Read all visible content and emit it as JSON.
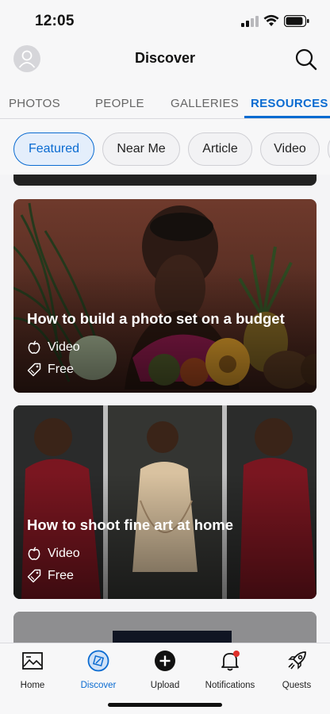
{
  "status_bar": {
    "time": "12:05"
  },
  "header": {
    "title": "Discover",
    "avatar_icon": "person-avatar-icon",
    "search_icon": "search-icon"
  },
  "tabs": [
    {
      "label": "PHOTOS",
      "active": false
    },
    {
      "label": "PEOPLE",
      "active": false
    },
    {
      "label": "GALLERIES",
      "active": false
    },
    {
      "label": "RESOURCES",
      "active": true
    }
  ],
  "filters": [
    {
      "label": "Featured",
      "active": true
    },
    {
      "label": "Near Me",
      "active": false
    },
    {
      "label": "Article",
      "active": false
    },
    {
      "label": "Video",
      "active": false
    }
  ],
  "cards": [
    {
      "title": "How to build a photo set on a budget",
      "type": "Video",
      "price": "Free"
    },
    {
      "title": "How to shoot fine art at home",
      "type": "Video",
      "price": "Free"
    }
  ],
  "tab_bar": [
    {
      "label": "Home",
      "icon": "home-image-icon",
      "active": false
    },
    {
      "label": "Discover",
      "icon": "discover-compass-icon",
      "active": true
    },
    {
      "label": "Upload",
      "icon": "upload-plus-icon",
      "active": false
    },
    {
      "label": "Notifications",
      "icon": "bell-icon",
      "active": false
    },
    {
      "label": "Quests",
      "icon": "rocket-icon",
      "active": false
    }
  ],
  "colors": {
    "accent": "#0a6bd1",
    "notification_dot": "#e0302a"
  }
}
